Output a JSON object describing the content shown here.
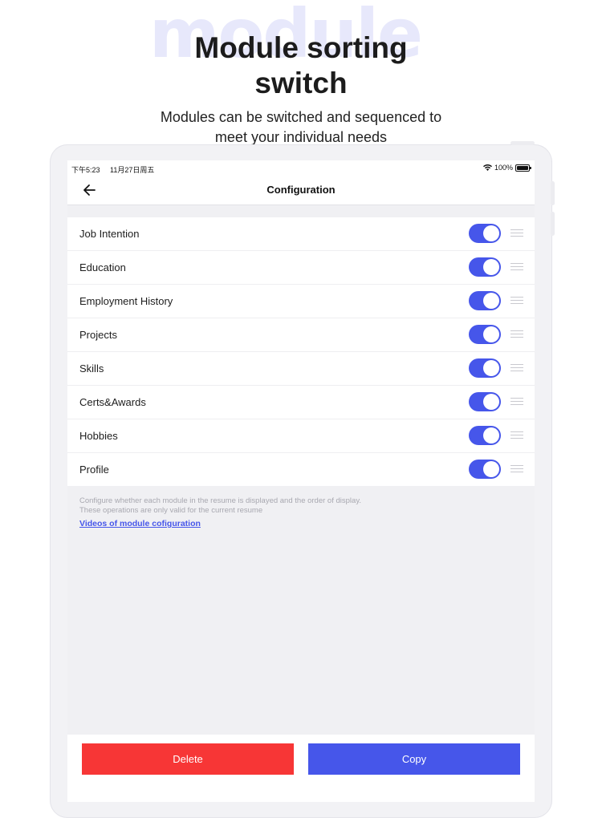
{
  "promo": {
    "watermark": "module",
    "title_line1": "Module sorting",
    "title_line2": "switch",
    "subtitle_line1": "Modules can be switched and sequenced to",
    "subtitle_line2": "meet your individual needs"
  },
  "statusbar": {
    "time": "下午5:23",
    "date": "11月27日周五",
    "battery": "100%"
  },
  "navbar": {
    "back_icon": "arrow-left-icon",
    "title": "Configuration"
  },
  "modules": [
    {
      "label": "Job Intention",
      "enabled": true
    },
    {
      "label": "Education",
      "enabled": true
    },
    {
      "label": "Employment History",
      "enabled": true
    },
    {
      "label": "Projects",
      "enabled": true
    },
    {
      "label": "Skills",
      "enabled": true
    },
    {
      "label": "Certs&Awards",
      "enabled": true
    },
    {
      "label": "Hobbies",
      "enabled": true
    },
    {
      "label": "Profile",
      "enabled": true
    }
  ],
  "note": {
    "line1": "Configure whether each module in the resume is displayed and the order of display.",
    "line2": "These operations are only valid for the current resume",
    "link": "Videos of module cofiguration"
  },
  "actions": {
    "delete_label": "Delete",
    "copy_label": "Copy"
  },
  "colors": {
    "accent": "#4656ea",
    "danger": "#f73636",
    "background": "#f0f0f3"
  }
}
